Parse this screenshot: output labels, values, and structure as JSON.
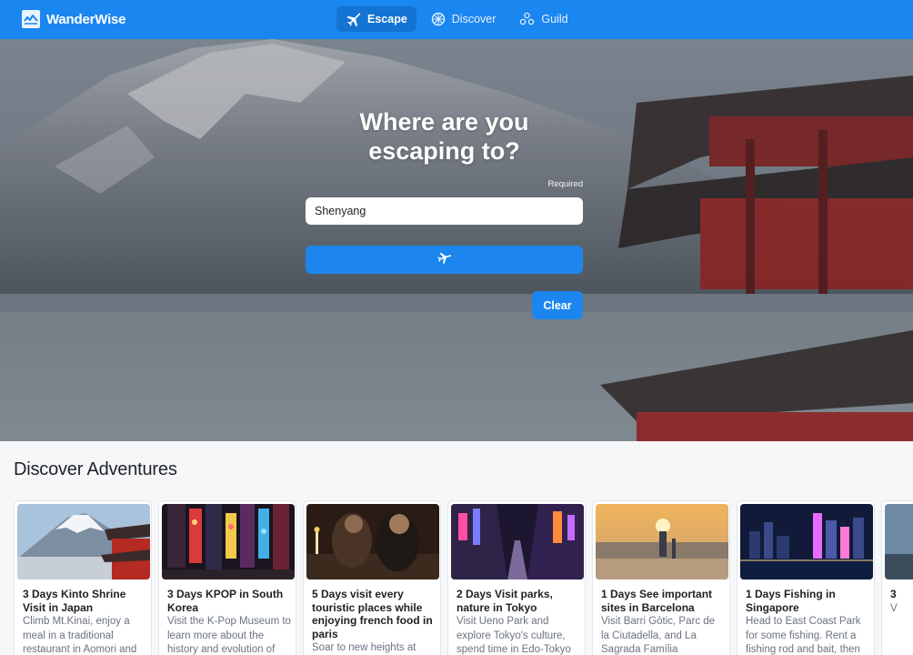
{
  "app": {
    "brand_name": "WanderWise",
    "brand_color": "#1a86ef",
    "nav_tabs": [
      {
        "label": "Escape",
        "icon": "plane-icon",
        "active": true
      },
      {
        "label": "Discover",
        "icon": "compass-icon",
        "active": false
      },
      {
        "label": "Guild",
        "icon": "people-icon",
        "active": false
      }
    ]
  },
  "hero": {
    "title_line1": "Where are you",
    "title_line2": "escaping to?",
    "required_label": "Required",
    "destination_value": "Shenyang",
    "submit_icon": "plane-icon",
    "clear_label": "Clear"
  },
  "discover": {
    "title": "Discover Adventures",
    "cards": [
      {
        "title": "3 Days Kinto Shrine Visit in Japan",
        "desc": "Climb Mt.Kinai, enjoy a meal in a traditional restaurant in Aomori and"
      },
      {
        "title": "3 Days KPOP in South Korea",
        "desc": "Visit the K-Pop Museum to learn more about the history and evolution of"
      },
      {
        "title": "5 Days visit every touristic places while enjoying french food in paris",
        "desc": "Soar to new heights at"
      },
      {
        "title": "2 Days Visit parks, nature in Tokyo",
        "desc": "Visit Ueno Park and explore Tokyo's culture, spend time in Edo-Tokyo"
      },
      {
        "title": "1 Days See important sites in Barcelona",
        "desc": "Visit Barri Gòtic, Parc de la Ciutadella, and La Sagrada Família"
      },
      {
        "title": "1 Days Fishing in Singapore",
        "desc": "Head to East Coast Park for some fishing. Rent a fishing rod and bait, then"
      },
      {
        "title": "3",
        "desc": "V"
      }
    ]
  }
}
